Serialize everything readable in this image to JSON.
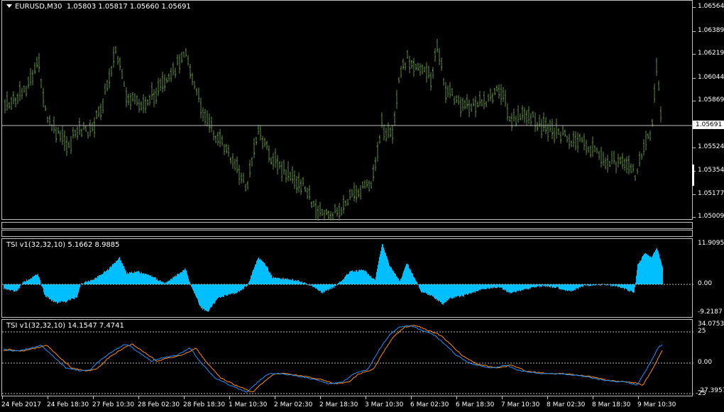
{
  "main": {
    "symbol_header": "EURUSD,M30",
    "ohlc": "1.05803 1.05817 1.05660 1.05691",
    "price_scale": [
      "1.06564",
      "1.06389",
      "1.06219",
      "1.06044",
      "1.05869",
      "1.05524",
      "1.05354",
      "1.05177",
      "1.05009"
    ],
    "current_price": "1.05691",
    "bar_color": "#5c8a3a",
    "line_color": "#c0c0c0"
  },
  "separators": [
    {},
    {}
  ],
  "tsi1": {
    "label": "TSI v1(32,32,10) 5.1662 8.9885",
    "scale": [
      "11.9095",
      "0.00",
      "-9.2187"
    ],
    "color": "#00bfff"
  },
  "tsi2": {
    "label": "TSI v1(32,32,10) 14.1547 7.4741",
    "scale": [
      "34.0753",
      "25",
      "0.00",
      "-27.3957",
      "-25"
    ],
    "line1_color": "#1e90ff",
    "line2_color": "#ff8c00"
  },
  "time_axis": [
    "24 Feb 2017",
    "24 Feb 18:30",
    "27 Feb 10:30",
    "28 Feb 02:30",
    "28 Feb 18:30",
    "1 Mar 10:30",
    "2 Mar 02:30",
    "2 Mar 18:30",
    "3 Mar 10:30",
    "6 Mar 02:30",
    "6 Mar 18:30",
    "7 Mar 10:30",
    "8 Mar 02:30",
    "8 Mar 18:30",
    "9 Mar 10:30"
  ]
}
